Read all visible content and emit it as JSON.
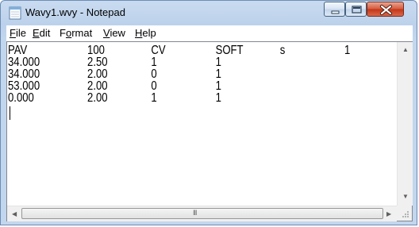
{
  "window": {
    "title": "Wavy1.wvy - Notepad",
    "accent_color": "#c2d6ee",
    "close_color": "#c43515"
  },
  "menu": {
    "file": {
      "pre": "",
      "key": "F",
      "post": "ile"
    },
    "edit": {
      "pre": "",
      "key": "E",
      "post": "dit"
    },
    "format": {
      "pre": "F",
      "key": "o",
      "post": "rmat"
    },
    "view": {
      "pre": "",
      "key": "V",
      "post": "iew"
    },
    "help": {
      "pre": "",
      "key": "H",
      "post": "elp"
    }
  },
  "document": {
    "rows": [
      [
        "PAV",
        "100",
        "CV",
        "SOFT",
        "s",
        "1"
      ],
      [
        "34.000",
        "2.50",
        "1",
        "1",
        "",
        ""
      ],
      [
        "34.000",
        "2.00",
        "0",
        "1",
        "",
        ""
      ],
      [
        "53.000",
        "2.00",
        "0",
        "1",
        "",
        ""
      ],
      [
        "0.000",
        "2.00",
        "1",
        "1",
        "",
        ""
      ]
    ]
  },
  "scrollbar": {
    "h_thumb_grip": "III",
    "left_arrow": "◀",
    "right_arrow": "▶",
    "up_arrow": "▲",
    "down_arrow": "▼"
  },
  "icons": {
    "app": "notepad-icon",
    "minimize": "minimize-icon",
    "maximize": "maximize-icon",
    "close": "close-icon"
  }
}
